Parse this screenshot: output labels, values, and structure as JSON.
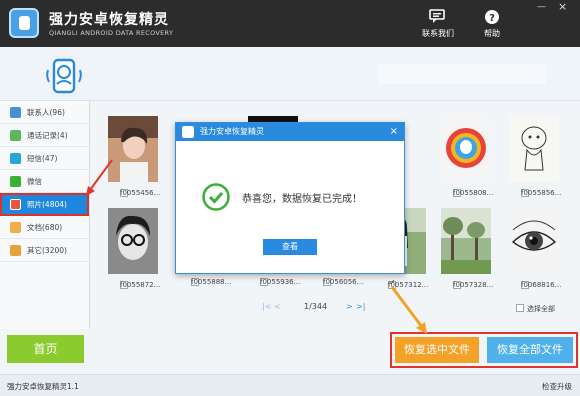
{
  "app": {
    "title": "强力安卓恢复精灵",
    "subtitle": "QIANGLI ANDROID DATA RECOVERY",
    "contact_label": "联系我们",
    "help_label": "帮助",
    "accent_color": "#1e87de"
  },
  "sidebar": {
    "items": [
      {
        "label": "联系人(96)",
        "icon": "contacts-icon",
        "color": "#4a90d9"
      },
      {
        "label": "通话记录(4)",
        "icon": "phone-icon",
        "color": "#5cb85c"
      },
      {
        "label": "短信(47)",
        "icon": "sms-icon",
        "color": "#2aa6d6"
      },
      {
        "label": "微信",
        "icon": "wechat-icon",
        "color": "#3cb034"
      },
      {
        "label": "照片(4804)",
        "icon": "photo-icon",
        "color": "#e9573f"
      },
      {
        "label": "文档(680)",
        "icon": "document-icon",
        "color": "#f0ad4e"
      },
      {
        "label": "其它(3200)",
        "icon": "other-icon",
        "color": "#e6a23c"
      }
    ]
  },
  "photos": [
    {
      "name": "f0055456...",
      "checked": false
    },
    {
      "name": "",
      "checked": false
    },
    {
      "name": "",
      "checked": false
    },
    {
      "name": "",
      "checked": false
    },
    {
      "name": "",
      "checked": false
    },
    {
      "name": "f0055808...",
      "checked": false
    },
    {
      "name": "f0055856...",
      "checked": false
    },
    {
      "name": "f0055872...",
      "checked": false
    },
    {
      "name": "f0055888...",
      "checked": false
    },
    {
      "name": "f0055936...",
      "checked": false
    },
    {
      "name": "f0056056...",
      "checked": false
    },
    {
      "name": "f0057312...",
      "checked": true
    },
    {
      "name": "f0057328...",
      "checked": false
    },
    {
      "name": "f0068816...",
      "checked": false
    }
  ],
  "pager": {
    "first": "|<",
    "prev": "<",
    "page": "1/344",
    "next": ">",
    "last": ">|"
  },
  "select_all_label": "选择全部",
  "buttons": {
    "home": "首页",
    "recover_selected": "恢复选中文件",
    "recover_all": "恢复全部文件"
  },
  "status": {
    "version": "强力安卓恢复精灵1.1",
    "upgrade": "检查升级"
  },
  "dialog": {
    "title": "强力安卓恢复精灵",
    "close": "×",
    "message": "恭喜您，数据恢复已完成！",
    "view_button": "查看"
  }
}
